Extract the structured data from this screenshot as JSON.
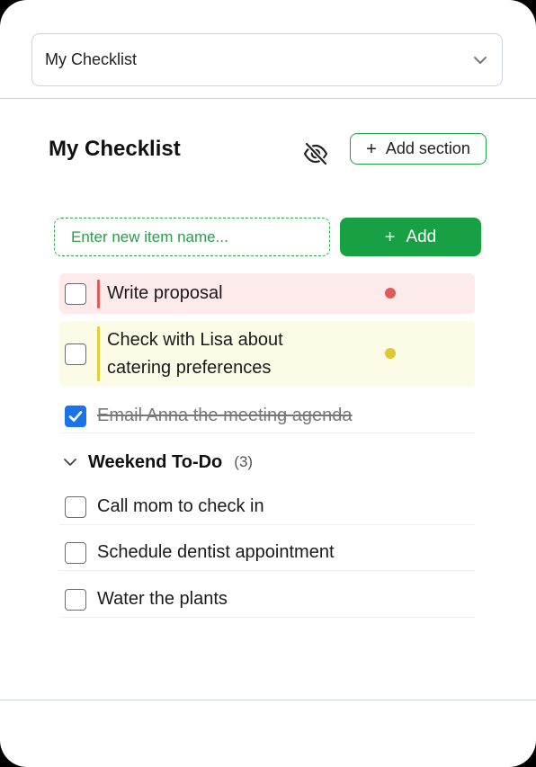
{
  "checklist_selector": {
    "value": "My Checklist"
  },
  "header": {
    "title": "My Checklist",
    "add_section_label": "Add section"
  },
  "new_item": {
    "placeholder": "Enter new item name...",
    "add_label": "Add"
  },
  "items": [
    {
      "text": "Write proposal",
      "checked": false,
      "priority_color": "#e05a5a"
    },
    {
      "text": "Check with Lisa about catering preferences",
      "checked": false,
      "priority_color": "#dcc934"
    },
    {
      "text": "Email Anna the meeting agenda",
      "checked": true
    }
  ],
  "section": {
    "title": "Weekend To-Do",
    "count": "(3)",
    "items": [
      {
        "text": "Call mom to check in",
        "checked": false
      },
      {
        "text": "Schedule dentist appointment",
        "checked": false
      },
      {
        "text": "Water the plants",
        "checked": false
      }
    ]
  },
  "colors": {
    "accent_green": "#17a144",
    "checkbox_blue": "#1a73e8"
  },
  "icons": {
    "visibility": "eye-off-icon",
    "selector_chevron": "chevron-down-icon",
    "section_chevron": "chevron-down-icon"
  }
}
